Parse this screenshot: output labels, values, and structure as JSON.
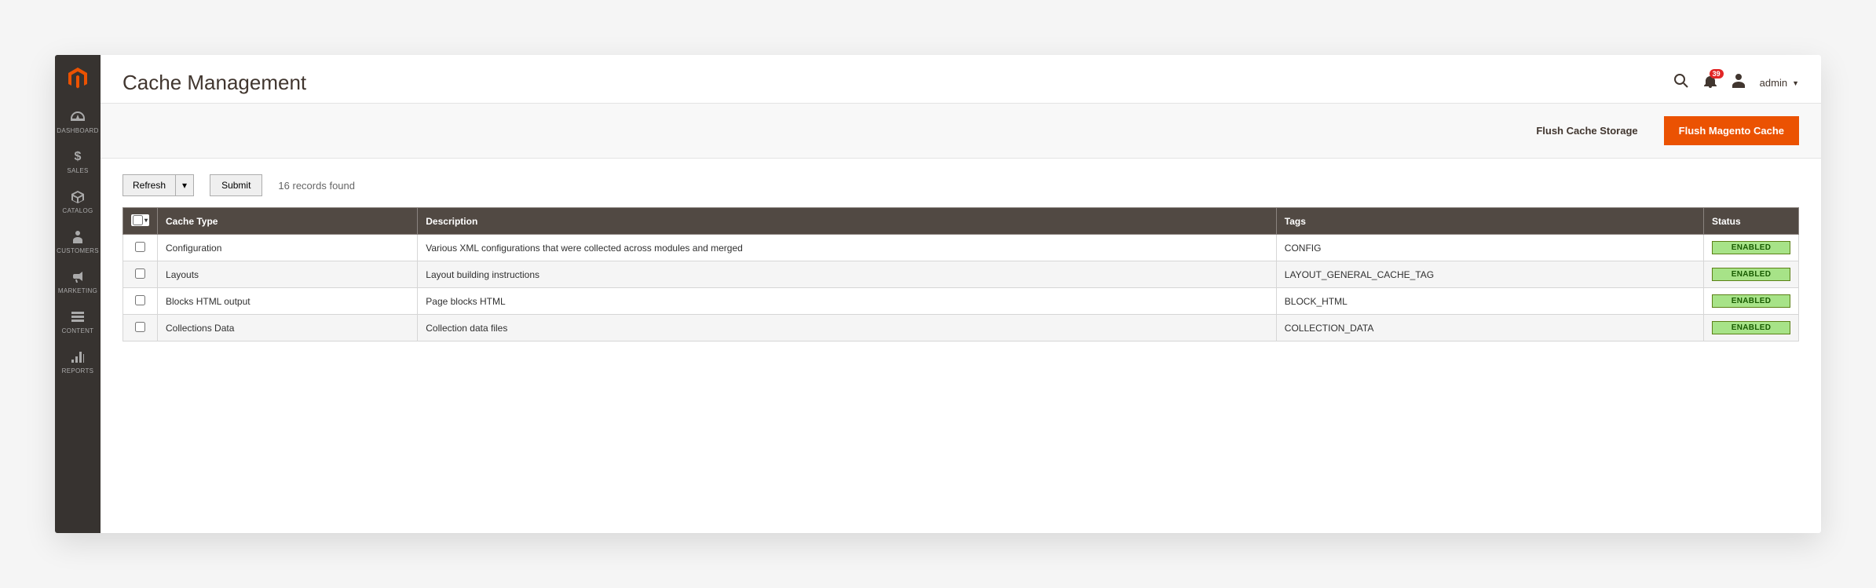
{
  "colors": {
    "accent": "#eb5202",
    "sidebar": "#373330",
    "tableHeader": "#514943",
    "statusBg": "#a7e388",
    "badge": "#e22626"
  },
  "sidebar": {
    "items": [
      {
        "label": "DASHBOARD",
        "icon": "dashboard-icon"
      },
      {
        "label": "SALES",
        "icon": "dollar-icon"
      },
      {
        "label": "CATALOG",
        "icon": "cube-icon"
      },
      {
        "label": "CUSTOMERS",
        "icon": "person-icon"
      },
      {
        "label": "MARKETING",
        "icon": "megaphone-icon"
      },
      {
        "label": "CONTENT",
        "icon": "layers-icon"
      },
      {
        "label": "REPORTS",
        "icon": "chart-icon"
      }
    ]
  },
  "header": {
    "title": "Cache Management",
    "notification_count": "39",
    "user_label": "admin"
  },
  "actions": {
    "flush_storage": "Flush Cache Storage",
    "flush_magento": "Flush Magento Cache"
  },
  "toolbar": {
    "refresh_label": "Refresh",
    "submit_label": "Submit",
    "records_found": "16 records found"
  },
  "table": {
    "headers": {
      "cache_type": "Cache Type",
      "description": "Description",
      "tags": "Tags",
      "status": "Status"
    },
    "rows": [
      {
        "type": "Configuration",
        "desc": "Various XML configurations that were collected across modules and merged",
        "tags": "CONFIG",
        "status": "ENABLED"
      },
      {
        "type": "Layouts",
        "desc": "Layout building instructions",
        "tags": "LAYOUT_GENERAL_CACHE_TAG",
        "status": "ENABLED"
      },
      {
        "type": "Blocks HTML output",
        "desc": "Page blocks HTML",
        "tags": "BLOCK_HTML",
        "status": "ENABLED"
      },
      {
        "type": "Collections Data",
        "desc": "Collection data files",
        "tags": "COLLECTION_DATA",
        "status": "ENABLED"
      }
    ]
  }
}
